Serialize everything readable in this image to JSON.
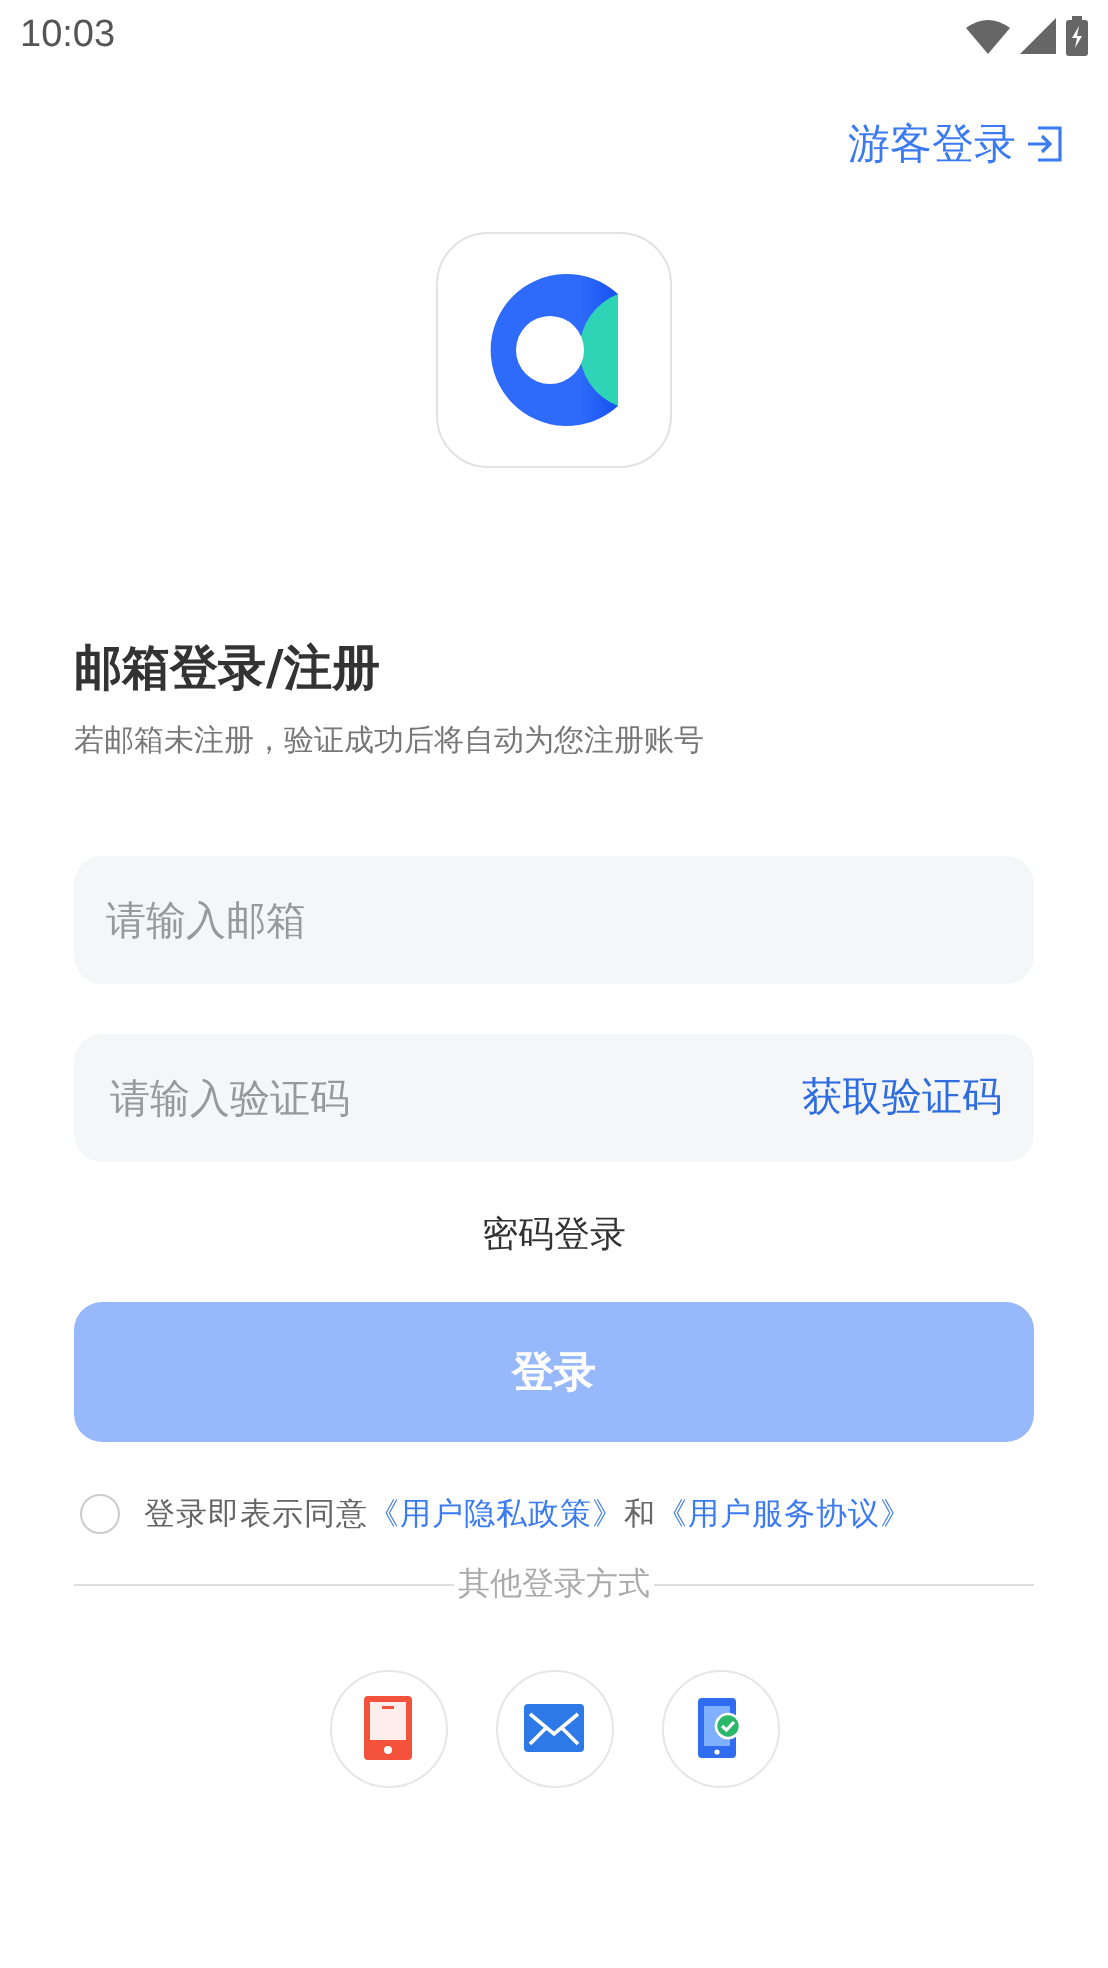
{
  "status_bar": {
    "time": "10:03"
  },
  "guest_login": {
    "label": "游客登录"
  },
  "title": "邮箱登录/注册",
  "subtitle": "若邮箱未注册，验证成功后将自动为您注册账号",
  "email_field": {
    "placeholder": "请输入邮箱"
  },
  "code_field": {
    "placeholder": "请输入验证码",
    "action": "获取验证码"
  },
  "password_login": "密码登录",
  "login_button": {
    "label": "登录",
    "disabled": true
  },
  "agreement": {
    "checked": false,
    "text": "登录即表示同意",
    "links": [
      "《用户隐私政策》",
      "《用户服务协议》"
    ],
    "joiner": "和"
  },
  "other_methods": {
    "title": "其他登录方式",
    "items": [
      {
        "kind": "phone"
      },
      {
        "kind": "email"
      },
      {
        "kind": "verified-phone"
      }
    ]
  }
}
